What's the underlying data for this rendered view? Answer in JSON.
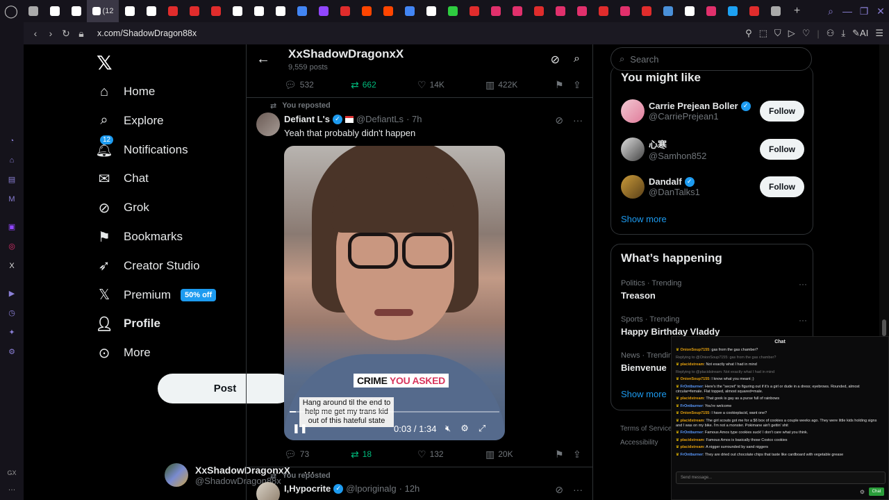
{
  "browser": {
    "active_tab_label": "(12",
    "url": "x.com/ShadowDragon88x",
    "ai_label": "AI",
    "tab_colors": [
      "#aaa",
      "#fff",
      "#fff",
      "#fff",
      "#fff",
      "#fff",
      "#e02c2c",
      "#e02c2c",
      "#e02c2c",
      "#fff",
      "#fff",
      "#fff",
      "#4285f4",
      "#9146ff",
      "#e02c2c",
      "#ff4500",
      "#ff4500",
      "#4285f4",
      "#fff",
      "#2ecc40",
      "#e02c2c",
      "#e1306c",
      "#e1306c",
      "#e02c2c",
      "#e1306c",
      "#e1306c",
      "#e02c2c",
      "#e1306c",
      "#e02c2c",
      "#4a90d9",
      "#fff",
      "#e1306c",
      "#1da1f2",
      "#e02c2c",
      "#aaa"
    ]
  },
  "nav": {
    "items": [
      {
        "label": "Home",
        "icon": "home-icon"
      },
      {
        "label": "Explore",
        "icon": "search-icon"
      },
      {
        "label": "Notifications",
        "icon": "bell-icon",
        "badge": "12"
      },
      {
        "label": "Chat",
        "icon": "mail-icon"
      },
      {
        "label": "Grok",
        "icon": "grok-icon"
      },
      {
        "label": "Bookmarks",
        "icon": "bookmark-icon"
      },
      {
        "label": "Creator Studio",
        "icon": "rocket-icon"
      },
      {
        "label": "Premium",
        "icon": "x-icon",
        "badge": "50% off"
      },
      {
        "label": "Profile",
        "icon": "person-icon"
      },
      {
        "label": "More",
        "icon": "more-circle-icon"
      }
    ],
    "post_label": "Post",
    "account": {
      "name": "XxShadowDragonxX",
      "handle": "@ShadowDragon88x"
    }
  },
  "profile_header": {
    "title": "XxShadowDragonxX",
    "posts": "9,559 posts"
  },
  "tweet0_actions": {
    "replies": "532",
    "reposts": "662",
    "likes": "14K",
    "views": "422K"
  },
  "tweet1": {
    "reposted_label": "You reposted",
    "name": "Defiant L's",
    "handle": "@DefiantLs",
    "time": "· 7h",
    "text": "Yeah that probably didn't happen",
    "video": {
      "caption_main_a": "CRIME ",
      "caption_main_b": "YOU ASKED",
      "caption_sub": "Hang around til the end to help me get my trans kid out of this hateful state",
      "time": "0:03 / 1:34",
      "progress": 0.03
    },
    "actions": {
      "replies": "73",
      "reposts": "18",
      "likes": "132",
      "views": "20K"
    }
  },
  "tweet2": {
    "reposted_label": "You reposted",
    "name": "I,Hypocrite",
    "handle": "@lporiginalg",
    "time": "· 12h"
  },
  "right": {
    "search_placeholder": "Search",
    "might_like_title": "You might like",
    "suggestions": [
      {
        "name": "Carrie Prejean Boller",
        "handle": "@CarriePrejean1",
        "verified": true,
        "follow": "Follow"
      },
      {
        "name": "心寒",
        "handle": "@Samhon852",
        "verified": false,
        "follow": "Follow"
      },
      {
        "name": "Dandalf",
        "handle": "@DanTalks1",
        "verified": true,
        "follow": "Follow"
      }
    ],
    "show_more": "Show more",
    "happening_title": "What’s happening",
    "trends": [
      {
        "category": "Politics · Trending",
        "name": "Treason"
      },
      {
        "category": "Sports · Trending",
        "name": "Happy Birthday Vladdy"
      },
      {
        "category": "News · Trending",
        "name": "Bienvenue"
      }
    ],
    "show_more2": "Show more",
    "footer_1": "Terms of Service",
    "footer_2": "Accessibility"
  },
  "chat": {
    "title": "Chat",
    "lines": [
      {
        "user": "OnionSoup7155",
        "text": ": gas from the gas chamber?",
        "color": "#e5a00d"
      },
      {
        "user": "",
        "text": "Replying to @OnionSoup7155: gas from the gas chamber?",
        "color": "#777"
      },
      {
        "user": "placidstream",
        "text": ": Not exactly what I had in mind",
        "color": "#e5a00d"
      },
      {
        "user": "",
        "text": "Replying to @placidstream: Not exactly what I had in mind",
        "color": "#777"
      },
      {
        "user": "OnionSoup7155",
        "text": ": I know what you meant ;)",
        "color": "#e5a00d"
      },
      {
        "user": "FrOntburner",
        "text": ": Here's the \"secret\" to figuring out if it's a girl or dude in a dress; eyebrows. Rounded, almost circular=female. Flat topped, almost squared=male.",
        "color": "#5b9bff"
      },
      {
        "user": "placidstream",
        "text": ": That gook is gay as a purse full of rainbows",
        "color": "#e5a00d"
      },
      {
        "user": "FrOntburner",
        "text": ": You're welcome",
        "color": "#5b9bff"
      },
      {
        "user": "OnionSoup7155",
        "text": ": I have a cookieplacid, want one?",
        "color": "#e5a00d"
      },
      {
        "user": "placidstream",
        "text": ": The girl scouts got me for a $6 box of cookies a couple weeks ago. They were little kids holding signs and I was on my bike. I'm not a monster. Pokimane ain't gettin' shit",
        "color": "#e5a00d"
      },
      {
        "user": "FrOntburner",
        "text": ": Famous Amos type cookies suck! I don't care what you think.",
        "color": "#5b9bff"
      },
      {
        "user": "placidstream",
        "text": ": Famous Amos is basically those Costco cookies",
        "color": "#e5a00d"
      },
      {
        "user": "placidstream",
        "text": ": A nigger surrounded by sand niggers",
        "color": "#e5a00d"
      },
      {
        "user": "FrOntburner",
        "text": ": They are dried out chocolate chips that taste like cardboard with vegetable grease",
        "color": "#5b9bff"
      }
    ],
    "input_placeholder": "Send message...",
    "send_label": "Chat"
  }
}
